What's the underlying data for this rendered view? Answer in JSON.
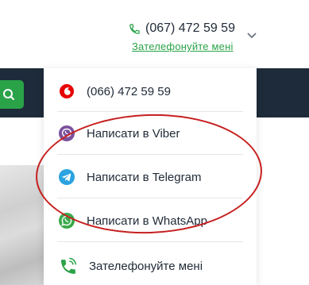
{
  "header": {
    "phone": "(067) 472 59 59",
    "callback_link": "Зателефонуйте мені"
  },
  "dropdown": {
    "items": [
      {
        "label": "(066) 472 59 59",
        "icon": "vodafone-icon"
      },
      {
        "label": "Написати в Viber",
        "icon": "viber-icon"
      },
      {
        "label": "Написати в Telegram",
        "icon": "telegram-icon"
      },
      {
        "label": "Написати в WhatsApp",
        "icon": "whatsapp-icon"
      },
      {
        "label": "Зателефонуйте мені",
        "icon": "phone-ringing-icon"
      }
    ]
  },
  "colors": {
    "accent_green": "#2aa348",
    "dark_nav": "#1e2b3a",
    "annotation_red": "#c71f1f",
    "viber": "#7b519d",
    "telegram": "#2aa3e0",
    "whatsapp": "#3aa84a",
    "vodafone": "#e60000"
  }
}
